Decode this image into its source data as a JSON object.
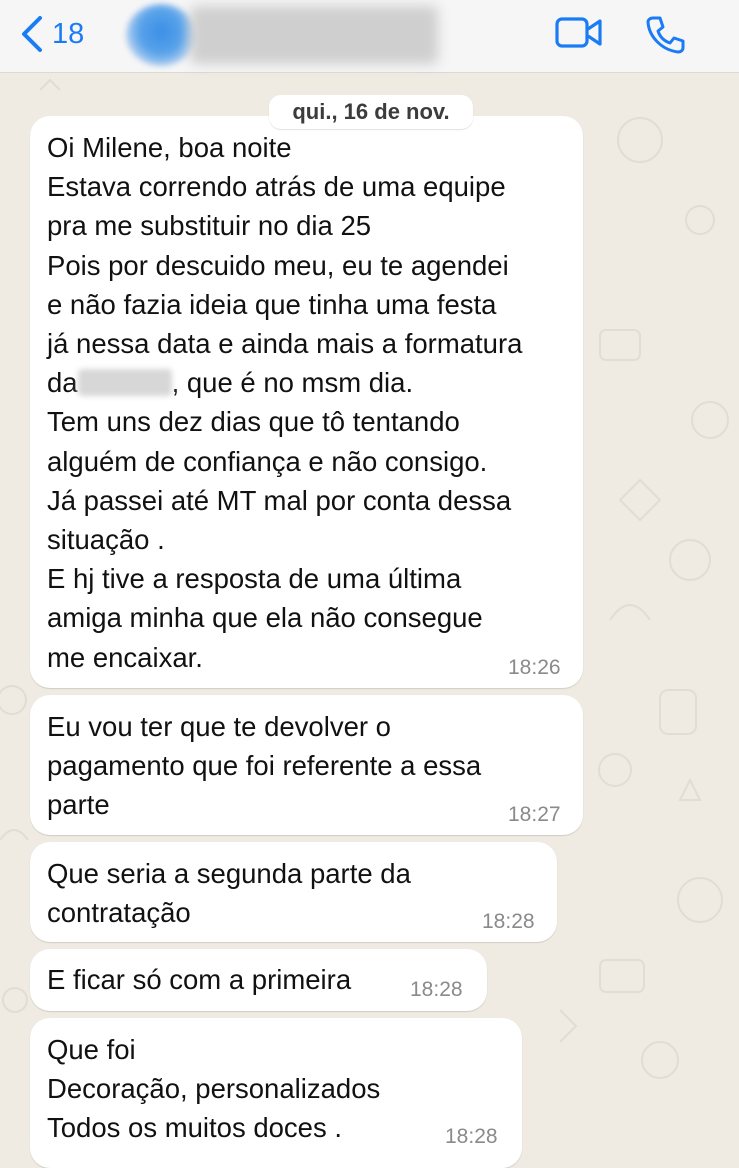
{
  "header": {
    "back_count": "18",
    "contact_name_redacted": true,
    "accent": "#1a7cf5"
  },
  "date_label": "qui., 16 de nov.",
  "messages": [
    {
      "lines": [
        "Oi Milene, boa noite",
        "Estava correndo atrás de uma equipe",
        "pra me substituir no dia 25",
        "Pois por descuido meu, eu te agendei",
        "e não fazia ideia que tinha uma festa",
        "já nessa data e ainda mais a formatura",
        "da",
        ", que é no msm dia.",
        "Tem uns dez dias que tô tentando",
        "alguém de confiança e não consigo.",
        "Já passei até MT mal por conta dessa",
        "situação .",
        "E hj tive a resposta de uma última",
        "amiga minha que ela não consegue",
        "me encaixar."
      ],
      "time": "18:26"
    },
    {
      "lines": [
        "Eu vou ter que te devolver o",
        "pagamento que foi referente a essa",
        "parte"
      ],
      "time": "18:27"
    },
    {
      "lines": [
        "Que seria a segunda parte da",
        "contratação"
      ],
      "time": "18:28"
    },
    {
      "lines": [
        "E ficar só com a primeira"
      ],
      "time": "18:28"
    },
    {
      "lines": [
        "Que foi",
        "Decoração, personalizados",
        "Todos os muitos doces ."
      ],
      "time": "18:28"
    }
  ],
  "colors": {
    "chat_background": "#efeae2",
    "bubble": "#ffffff",
    "timestamp": "#8a8a8a"
  }
}
